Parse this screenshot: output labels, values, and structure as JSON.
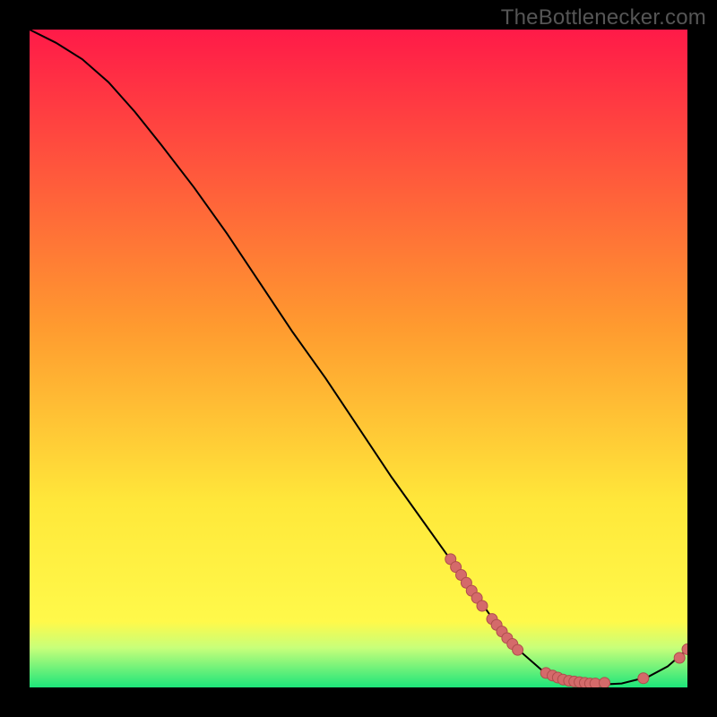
{
  "watermark": "TheBottlenecker.com",
  "colors": {
    "bg": "#000000",
    "watermark": "#555555",
    "curve": "#000000",
    "marker_fill": "#d46a6a",
    "marker_stroke": "#af4d4d",
    "gradient_top": "#ff1a48",
    "gradient_mid1": "#ff9a2f",
    "gradient_mid2": "#ffe83a",
    "gradient_band": "#c7ff7a",
    "gradient_bottom": "#1de57a"
  },
  "chart_data": {
    "type": "line",
    "title": "",
    "xlabel": "",
    "ylabel": "",
    "xlim": [
      0,
      100
    ],
    "ylim": [
      0,
      100
    ],
    "legend": false,
    "grid": false,
    "curve": [
      {
        "x": 0,
        "y": 100
      },
      {
        "x": 4,
        "y": 98
      },
      {
        "x": 8,
        "y": 95.5
      },
      {
        "x": 12,
        "y": 92
      },
      {
        "x": 16,
        "y": 87.5
      },
      {
        "x": 20,
        "y": 82.5
      },
      {
        "x": 25,
        "y": 76
      },
      {
        "x": 30,
        "y": 69
      },
      {
        "x": 35,
        "y": 61.5
      },
      {
        "x": 40,
        "y": 54
      },
      {
        "x": 45,
        "y": 47
      },
      {
        "x": 50,
        "y": 39.5
      },
      {
        "x": 55,
        "y": 32
      },
      {
        "x": 60,
        "y": 25
      },
      {
        "x": 65,
        "y": 18
      },
      {
        "x": 70,
        "y": 11
      },
      {
        "x": 74,
        "y": 6
      },
      {
        "x": 78,
        "y": 2.5
      },
      {
        "x": 82,
        "y": 0.8
      },
      {
        "x": 86,
        "y": 0.4
      },
      {
        "x": 90,
        "y": 0.6
      },
      {
        "x": 94,
        "y": 1.6
      },
      {
        "x": 97,
        "y": 3.2
      },
      {
        "x": 100,
        "y": 5.8
      }
    ],
    "markers": [
      {
        "x": 64.0,
        "y": 19.5
      },
      {
        "x": 64.8,
        "y": 18.3
      },
      {
        "x": 65.6,
        "y": 17.1
      },
      {
        "x": 66.4,
        "y": 15.9
      },
      {
        "x": 67.2,
        "y": 14.7
      },
      {
        "x": 68.0,
        "y": 13.6
      },
      {
        "x": 68.8,
        "y": 12.4
      },
      {
        "x": 70.3,
        "y": 10.4
      },
      {
        "x": 71.0,
        "y": 9.5
      },
      {
        "x": 71.8,
        "y": 8.5
      },
      {
        "x": 72.6,
        "y": 7.5
      },
      {
        "x": 73.4,
        "y": 6.6
      },
      {
        "x": 74.2,
        "y": 5.7
      },
      {
        "x": 78.5,
        "y": 2.2
      },
      {
        "x": 79.5,
        "y": 1.8
      },
      {
        "x": 80.3,
        "y": 1.5
      },
      {
        "x": 81.1,
        "y": 1.2
      },
      {
        "x": 82.0,
        "y": 1.0
      },
      {
        "x": 82.8,
        "y": 0.9
      },
      {
        "x": 83.6,
        "y": 0.8
      },
      {
        "x": 84.4,
        "y": 0.7
      },
      {
        "x": 85.2,
        "y": 0.6
      },
      {
        "x": 86.0,
        "y": 0.6
      },
      {
        "x": 87.4,
        "y": 0.7
      },
      {
        "x": 93.3,
        "y": 1.4
      },
      {
        "x": 98.8,
        "y": 4.5
      },
      {
        "x": 100.0,
        "y": 5.8
      }
    ]
  }
}
